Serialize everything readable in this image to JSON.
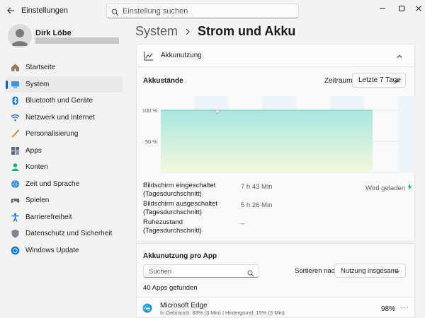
{
  "window": {
    "title": "Einstellungen",
    "search_placeholder": "Einstellung suchen"
  },
  "profile": {
    "name": "Dirk Löbe"
  },
  "sidebar": {
    "items": [
      {
        "label": "Startseite",
        "icon": "home-icon"
      },
      {
        "label": "System",
        "icon": "system-icon",
        "active": true
      },
      {
        "label": "Bluetooth und Geräte",
        "icon": "bluetooth-icon"
      },
      {
        "label": "Netzwerk und Internet",
        "icon": "wifi-icon"
      },
      {
        "label": "Personalisierung",
        "icon": "brush-icon"
      },
      {
        "label": "Apps",
        "icon": "apps-icon"
      },
      {
        "label": "Konten",
        "icon": "account-icon"
      },
      {
        "label": "Zeit und Sprache",
        "icon": "globe-clock-icon"
      },
      {
        "label": "Spielen",
        "icon": "gamepad-icon"
      },
      {
        "label": "Barrierefreiheit",
        "icon": "accessibility-icon"
      },
      {
        "label": "Datenschutz und Sicherheit",
        "icon": "shield-icon"
      },
      {
        "label": "Windows Update",
        "icon": "update-icon"
      }
    ]
  },
  "breadcrumb": {
    "parent": "System",
    "current": "Strom und Akku"
  },
  "battery_usage": {
    "section_title": "Akkunutzung",
    "chart_title": "Akkustände",
    "period_label": "Zeitraum:",
    "period_value": "Letzte 7 Tage",
    "stats": [
      {
        "label_line1": "Bildschirm eingeschaltet",
        "label_line2": "(Tagesdurchschnitt)",
        "value": "7 h 43 Min"
      },
      {
        "label_line1": "Bildschirm ausgeschaltet",
        "label_line2": "(Tagesdurchschnitt)",
        "value": "5 h 26 Min"
      },
      {
        "label_line1": "Ruhezustand",
        "label_line2": "(Tagesdurchschnitt)",
        "value": "–"
      }
    ],
    "charging_status": "Wird geladen"
  },
  "chart_data": {
    "type": "area",
    "title": "Akkustände",
    "y_ticks": [
      "100 %",
      "50 %"
    ],
    "ylim": [
      0,
      100
    ],
    "x": [
      0,
      1
    ],
    "values": [
      100,
      100
    ],
    "grid": true,
    "colors": {
      "fill_top": "#a8e6e0",
      "fill_bottom": "#f4f8dc",
      "line": "#5fc9c0"
    }
  },
  "app_usage": {
    "title": "Akkunutzung pro App",
    "search_placeholder": "Suchen",
    "sort_label": "Sortieren nach:",
    "sort_value": "Nutzung insgesamt",
    "count_text": "40 Apps gefunden",
    "apps": [
      {
        "name": "Microsoft Edge",
        "detail": "In Gebrauch: 83% (3 Min) | Hintergrund: 15% (3 Min)",
        "percent": "98%",
        "more": "···"
      }
    ]
  },
  "colors": {
    "accent": "#005fb8"
  }
}
